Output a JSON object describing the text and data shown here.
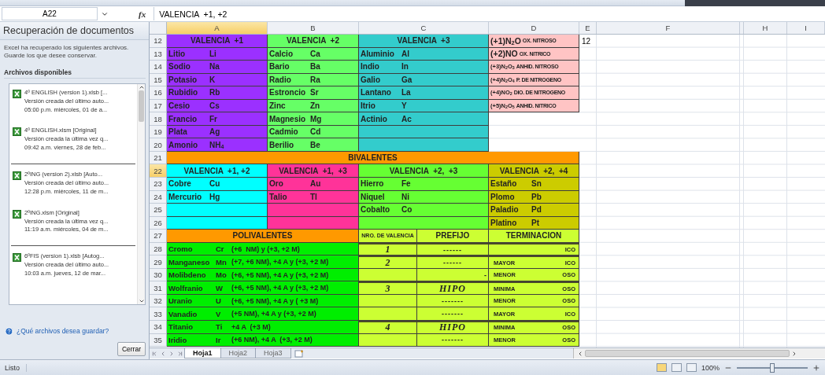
{
  "formula_bar": {
    "name_box": "A22",
    "function_label": "fx",
    "formula": "VALENCIA  +1, +2"
  },
  "recovery_panel": {
    "title": "Recuperación de documentos",
    "description": "Excel ha recuperado los siguientes archivos. Guarde los que desee conservar.",
    "list_title": "Archivos disponibles",
    "file_groups": [
      {
        "files": [
          {
            "name": "4º ENGLISH (version 1).xlsb  [...",
            "info": "Versión creada del último auto...",
            "date": "05:00 p.m. miércoles, 01 de a..."
          },
          {
            "name": "4º ENGLISH.xlsm  [Original]",
            "info": "Versión creada la última vez q...",
            "date": "09:42 a.m. viernes, 28 de feb..."
          }
        ]
      },
      {
        "files": [
          {
            "name": "2ºING (version 2).xlsb  [Auto...",
            "info": "Versión creada del último auto...",
            "date": "12:28 p.m. miércoles, 11 de m..."
          },
          {
            "name": "2ºING.xlsm  [Original]",
            "info": "Versión creada la última vez q...",
            "date": "11:19 a.m. miércoles, 04 de m..."
          }
        ]
      },
      {
        "files": [
          {
            "name": "6ºFIS (version 1).xlsb  [Autog...",
            "info": "Versión creada del último auto...",
            "date": "10:03 a.m. jueves, 12 de mar..."
          }
        ]
      }
    ],
    "help_link": "¿Qué archivos desea guardar?",
    "close_button": "Cerrar"
  },
  "columns": [
    {
      "label": "A",
      "selected": true
    },
    {
      "label": "B",
      "selected": false
    },
    {
      "label": "C",
      "selected": false
    },
    {
      "label": "D",
      "selected": false
    },
    {
      "label": "E",
      "selected": false
    },
    {
      "label": "F",
      "selected": false
    },
    {
      "selected": false
    },
    {
      "label": "H",
      "selected": false
    },
    {
      "label": "I",
      "selected": false
    }
  ],
  "rows": [
    {
      "num": "12",
      "active": false,
      "e": "12",
      "cells": [
        {
          "kind": "head",
          "merged": false,
          "color": "#9b30ff",
          "parts": [
            "VALENCIA  +1"
          ]
        },
        {
          "kind": "head",
          "merged": false,
          "color": "#66ff66",
          "parts": [
            "VALENCIA  +2"
          ]
        },
        {
          "kind": "head",
          "merged": true,
          "color": "#33cccc",
          "parts": [
            "VALENCIA  +3"
          ]
        },
        {
          "kind": "oxide",
          "merged": false,
          "large": true,
          "color": "#ffc4c4",
          "parts": [
            "(+1)N$_{2}$O",
            "OX. NITROSO"
          ]
        }
      ]
    },
    {
      "num": "13",
      "active": false,
      "cells": [
        {
          "kind": "entry",
          "merged": false,
          "color": "#9b30ff",
          "parts": [
            "Litio",
            "Li"
          ]
        },
        {
          "kind": "entry",
          "merged": false,
          "color": "#66ff66",
          "parts": [
            "Calcio",
            "Ca"
          ]
        },
        {
          "kind": "entry",
          "merged": true,
          "color": "#33cccc",
          "parts": [
            "Aluminio",
            "Al"
          ]
        },
        {
          "kind": "oxide",
          "merged": false,
          "large": true,
          "color": "#ffc4c4",
          "parts": [
            "(+2)NO",
            "OX. NITRICO"
          ]
        }
      ]
    },
    {
      "num": "14",
      "active": false,
      "cells": [
        {
          "kind": "entry",
          "merged": false,
          "color": "#9b30ff",
          "parts": [
            "Sodio",
            "Na"
          ]
        },
        {
          "kind": "entry",
          "merged": false,
          "color": "#66ff66",
          "parts": [
            "Bario",
            "Ba"
          ]
        },
        {
          "kind": "entry",
          "merged": true,
          "color": "#33cccc",
          "parts": [
            "Indio",
            "In"
          ]
        },
        {
          "kind": "oxide",
          "merged": false,
          "large": false,
          "color": "#ffc4c4",
          "parts": [
            "(+3)N$_{2}$O$_{3}$",
            "ANHID. NITROSO"
          ]
        }
      ]
    },
    {
      "num": "15",
      "active": false,
      "cells": [
        {
          "kind": "entry",
          "merged": false,
          "color": "#9b30ff",
          "parts": [
            "Potasio",
            "K"
          ]
        },
        {
          "kind": "entry",
          "merged": false,
          "color": "#66ff66",
          "parts": [
            "Radio",
            "Ra"
          ]
        },
        {
          "kind": "entry",
          "merged": true,
          "color": "#33cccc",
          "parts": [
            "Galio",
            "Ga"
          ]
        },
        {
          "kind": "oxide",
          "merged": false,
          "large": false,
          "color": "#ffc4c4",
          "parts": [
            "(+4)N$_{2}$O$_{4}$",
            "P. DE NITROGENO"
          ]
        }
      ]
    },
    {
      "num": "16",
      "active": false,
      "cells": [
        {
          "kind": "entry",
          "merged": false,
          "color": "#9b30ff",
          "parts": [
            "Rubidio",
            "Rb"
          ]
        },
        {
          "kind": "entry",
          "merged": false,
          "color": "#66ff66",
          "parts": [
            "Estroncio",
            "Sr"
          ]
        },
        {
          "kind": "entry",
          "merged": true,
          "color": "#33cccc",
          "parts": [
            "Lantano",
            "La"
          ]
        },
        {
          "kind": "oxide",
          "merged": false,
          "large": false,
          "color": "#ffc4c4",
          "parts": [
            "(+4)NO$_{2}$",
            "DIO. DE NITROGENO"
          ]
        }
      ]
    },
    {
      "num": "17",
      "active": false,
      "cells": [
        {
          "kind": "entry",
          "merged": false,
          "color": "#9b30ff",
          "parts": [
            "Cesio",
            "Cs"
          ]
        },
        {
          "kind": "entry",
          "merged": false,
          "color": "#66ff66",
          "parts": [
            "Zinc",
            "Zn"
          ]
        },
        {
          "kind": "entry",
          "merged": true,
          "color": "#33cccc",
          "parts": [
            "Itrio",
            "Y"
          ]
        },
        {
          "kind": "oxide",
          "merged": false,
          "large": false,
          "color": "#ffc4c4",
          "parts": [
            "(+5)N$_{2}$O$_{5}$",
            "ANHID. NITRICO"
          ]
        }
      ]
    },
    {
      "num": "18",
      "active": false,
      "cells": [
        {
          "kind": "entry",
          "merged": false,
          "color": "#9b30ff",
          "parts": [
            "Francio",
            "Fr"
          ]
        },
        {
          "kind": "entry",
          "merged": false,
          "color": "#66ff66",
          "parts": [
            "Magnesio",
            "Mg"
          ]
        },
        {
          "kind": "entry",
          "merged": true,
          "color": "#33cccc",
          "parts": [
            "Actinio",
            "Ac"
          ]
        },
        {
          "kind": "blank",
          "merged": false
        }
      ]
    },
    {
      "num": "19",
      "active": false,
      "cells": [
        {
          "kind": "entry",
          "merged": false,
          "color": "#9b30ff",
          "parts": [
            "Plata",
            "Ag"
          ]
        },
        {
          "kind": "entry",
          "merged": false,
          "color": "#66ff66",
          "parts": [
            "Cadmio",
            "Cd"
          ]
        },
        {
          "kind": "blank",
          "merged": true,
          "color": "#33cccc"
        },
        {
          "kind": "blank",
          "merged": false
        }
      ]
    },
    {
      "num": "20",
      "active": false,
      "cells": [
        {
          "kind": "entry",
          "merged": false,
          "color": "#9b30ff",
          "parts": [
            "Amonio",
            "NH$_{4}$"
          ]
        },
        {
          "kind": "entry",
          "merged": false,
          "color": "#66ff66",
          "parts": [
            "Berilio",
            "Be"
          ]
        },
        {
          "kind": "blank",
          "merged": true,
          "color": "#33cccc"
        },
        {
          "kind": "blank",
          "merged": false
        }
      ]
    },
    {
      "num": "21",
      "active": false,
      "cells": [
        {
          "kind": "title",
          "color": "#ff9900",
          "parts": [
            "BIVALENTES"
          ]
        }
      ]
    },
    {
      "num": "22",
      "active": true,
      "cells": [
        {
          "kind": "head",
          "merged": false,
          "color": "#00ffff",
          "parts": [
            "VALENCIA  +1, +2"
          ]
        },
        {
          "kind": "head",
          "merged": false,
          "color": "#ff3399",
          "parts": [
            "VALENCIA  +1,  +3"
          ]
        },
        {
          "kind": "head",
          "merged": true,
          "color": "#66ff33",
          "parts": [
            "VALENCIA  +2,  +3"
          ]
        },
        {
          "kind": "head",
          "merged": false,
          "color": "#cccc00",
          "parts": [
            "VALENCIA  +2,  +4"
          ]
        }
      ]
    },
    {
      "num": "23",
      "active": false,
      "cells": [
        {
          "kind": "entry",
          "merged": false,
          "color": "#00ffff",
          "parts": [
            "Cobre",
            "Cu"
          ]
        },
        {
          "kind": "entry",
          "merged": false,
          "color": "#ff3399",
          "parts": [
            "Oro",
            "Au"
          ]
        },
        {
          "kind": "entry",
          "merged": true,
          "color": "#66ff33",
          "parts": [
            "Hierro",
            "Fe"
          ]
        },
        {
          "kind": "entry",
          "merged": false,
          "color": "#cccc00",
          "parts": [
            "Estaño",
            "Sn"
          ]
        }
      ]
    },
    {
      "num": "24",
      "active": false,
      "cells": [
        {
          "kind": "entry",
          "merged": false,
          "color": "#00ffff",
          "parts": [
            "Mercurio",
            "Hg"
          ]
        },
        {
          "kind": "entry",
          "merged": false,
          "color": "#ff3399",
          "parts": [
            "Talio",
            "Tl"
          ]
        },
        {
          "kind": "entry",
          "merged": true,
          "color": "#66ff33",
          "parts": [
            "Niquel",
            "Ni"
          ]
        },
        {
          "kind": "entry",
          "merged": false,
          "color": "#cccc00",
          "parts": [
            "Plomo",
            "Pb"
          ]
        }
      ]
    },
    {
      "num": "25",
      "active": false,
      "cells": [
        {
          "kind": "blank",
          "merged": false,
          "color": "#00ffff"
        },
        {
          "kind": "blank",
          "merged": false,
          "color": "#ff3399"
        },
        {
          "kind": "entry",
          "merged": true,
          "color": "#66ff33",
          "parts": [
            "Cobalto",
            "Co"
          ]
        },
        {
          "kind": "entry",
          "merged": false,
          "color": "#cccc00",
          "parts": [
            "Paladio",
            "Pd"
          ]
        }
      ]
    },
    {
      "num": "26",
      "active": false,
      "cells": [
        {
          "kind": "blank",
          "merged": false,
          "color": "#00ffff"
        },
        {
          "kind": "blank",
          "merged": false,
          "color": "#ff3399"
        },
        {
          "kind": "blank",
          "merged": true,
          "color": "#66ff33"
        },
        {
          "kind": "entry",
          "merged": false,
          "color": "#cccc00",
          "parts": [
            "Platino",
            "Pt"
          ]
        }
      ]
    },
    {
      "num": "27",
      "active": false,
      "cells": [
        {
          "kind": "head",
          "merged": true,
          "color": "#ff9900",
          "parts": [
            "POLIVALENTES"
          ]
        },
        {
          "kind": "label",
          "merged": false,
          "color": "#ccff33",
          "parts": [
            "NRO. DE VALENCIA"
          ]
        },
        {
          "kind": "head",
          "merged": false,
          "color": "#ccff33",
          "parts": [
            "PREFIJO"
          ]
        },
        {
          "kind": "head",
          "merged": false,
          "color": "#ccff33",
          "parts": [
            "TERMINACION"
          ]
        }
      ]
    },
    {
      "num": "28",
      "active": false,
      "cells": [
        {
          "kind": "poli",
          "merged": true,
          "color": "#00ee00",
          "parts": [
            "Cromo",
            "Cr",
            "(+6  NM) y (+3, +2 M)"
          ]
        },
        {
          "kind": "num",
          "merged": false,
          "color": "#ccff33",
          "group_start": true,
          "parts": [
            "1"
          ]
        },
        {
          "kind": "prefix",
          "merged": false,
          "color": "#ccff33",
          "group_start": true,
          "parts": [
            "------"
          ]
        },
        {
          "kind": "term",
          "merged": false,
          "color": "#ccff33",
          "group_start": true,
          "parts": [
            "ICO"
          ]
        }
      ]
    },
    {
      "num": "29",
      "active": false,
      "cells": [
        {
          "kind": "poli",
          "merged": true,
          "color": "#00ee00",
          "parts": [
            "Manganeso",
            "Mn",
            "(+7, +6 NM), +4 A y (+3, +2 M)"
          ]
        },
        {
          "kind": "num",
          "merged": false,
          "color": "#ccff33",
          "group_start": true,
          "parts": [
            "2"
          ]
        },
        {
          "kind": "prefix",
          "merged": false,
          "color": "#ccff33",
          "group_start": true,
          "parts": [
            "------"
          ]
        },
        {
          "kind": "term",
          "merged": false,
          "color": "#ccff33",
          "group_start": true,
          "parts": [
            "MAYOR",
            "ICO"
          ]
        }
      ]
    },
    {
      "num": "30",
      "active": false,
      "cells": [
        {
          "kind": "poli",
          "merged": true,
          "color": "#00ee00",
          "parts": [
            "Molibdeno",
            "Mo",
            "(+6, +5 NM), +4 A y (+3, +2 M)"
          ]
        },
        {
          "kind": "num",
          "merged": false,
          "color": "#ccff33",
          "group_start": false
        },
        {
          "kind": "mark",
          "merged": false,
          "color": "#ccff33",
          "group_start": false,
          "parts": [
            "-"
          ]
        },
        {
          "kind": "term",
          "merged": false,
          "color": "#ccff33",
          "group_start": false,
          "parts": [
            "MENOR",
            "OSO"
          ]
        }
      ]
    },
    {
      "num": "31",
      "active": false,
      "cells": [
        {
          "kind": "poli",
          "merged": true,
          "color": "#00ee00",
          "parts": [
            "Wolfranio",
            "W",
            "(+6, +5 NM), +4 A y (+3, +2 M)"
          ]
        },
        {
          "kind": "num",
          "merged": false,
          "color": "#ccff33",
          "group_start": true,
          "parts": [
            "3"
          ]
        },
        {
          "kind": "prefix",
          "merged": false,
          "color": "#ccff33",
          "group_start": true,
          "parts": [
            "HIPO"
          ]
        },
        {
          "kind": "term",
          "merged": false,
          "color": "#ccff33",
          "group_start": true,
          "parts": [
            "MINIMA",
            "OSO"
          ]
        }
      ]
    },
    {
      "num": "32",
      "active": false,
      "cells": [
        {
          "kind": "poli",
          "merged": true,
          "color": "#00ee00",
          "parts": [
            "Uranio",
            "U",
            "(+6, +5 NM), +4 A y ( +3 M)"
          ]
        },
        {
          "kind": "num",
          "merged": false,
          "color": "#ccff33",
          "group_start": false
        },
        {
          "kind": "prefix",
          "merged": false,
          "color": "#ccff33",
          "group_start": false,
          "parts": [
            "-------"
          ]
        },
        {
          "kind": "term",
          "merged": false,
          "color": "#ccff33",
          "group_start": false,
          "parts": [
            "MENOR",
            "OSO"
          ]
        }
      ]
    },
    {
      "num": "33",
      "active": false,
      "cells": [
        {
          "kind": "poli",
          "merged": true,
          "color": "#00ee00",
          "parts": [
            "Vanadio",
            "V",
            "(+5 NM), +4 A y (+3, +2 M)"
          ]
        },
        {
          "kind": "num",
          "merged": false,
          "color": "#ccff33",
          "group_start": false
        },
        {
          "kind": "prefix",
          "merged": false,
          "color": "#ccff33",
          "group_start": false,
          "parts": [
            "-------"
          ]
        },
        {
          "kind": "term",
          "merged": false,
          "color": "#ccff33",
          "group_start": false,
          "parts": [
            "MAYOR",
            "ICO"
          ]
        }
      ]
    },
    {
      "num": "34",
      "active": false,
      "cells": [
        {
          "kind": "poli",
          "merged": true,
          "color": "#00ee00",
          "parts": [
            "Titanio",
            "Ti",
            "+4 A  (+3 M)"
          ]
        },
        {
          "kind": "num",
          "merged": false,
          "color": "#ccff33",
          "group_start": true,
          "parts": [
            "4"
          ]
        },
        {
          "kind": "prefix",
          "merged": false,
          "color": "#ccff33",
          "group_start": true,
          "parts": [
            "HIPO"
          ]
        },
        {
          "kind": "term",
          "merged": false,
          "color": "#ccff33",
          "group_start": true,
          "parts": [
            "MINIMA",
            "OSO"
          ]
        }
      ]
    },
    {
      "num": "35",
      "active": false,
      "cells": [
        {
          "kind": "poli",
          "merged": true,
          "color": "#00ee00",
          "parts": [
            "Iridio",
            "Ir",
            "(+6 NM), +4 A  (+3, +2 M)"
          ]
        },
        {
          "kind": "num",
          "merged": false,
          "color": "#ccff33",
          "group_start": false
        },
        {
          "kind": "prefix",
          "merged": false,
          "color": "#ccff33",
          "group_start": false,
          "parts": [
            "-------"
          ]
        },
        {
          "kind": "term",
          "merged": false,
          "color": "#ccff33",
          "group_start": false,
          "parts": [
            "MENOR",
            "OSO"
          ]
        }
      ]
    }
  ],
  "sheet_tabs": [
    {
      "label": "Hoja1",
      "selected": true
    },
    {
      "label": "Hoja2",
      "selected": false
    },
    {
      "label": "Hoja3",
      "selected": false
    }
  ],
  "status_bar": {
    "status": "Listo",
    "zoom": {
      "label": "100%",
      "level": 0.5
    }
  }
}
